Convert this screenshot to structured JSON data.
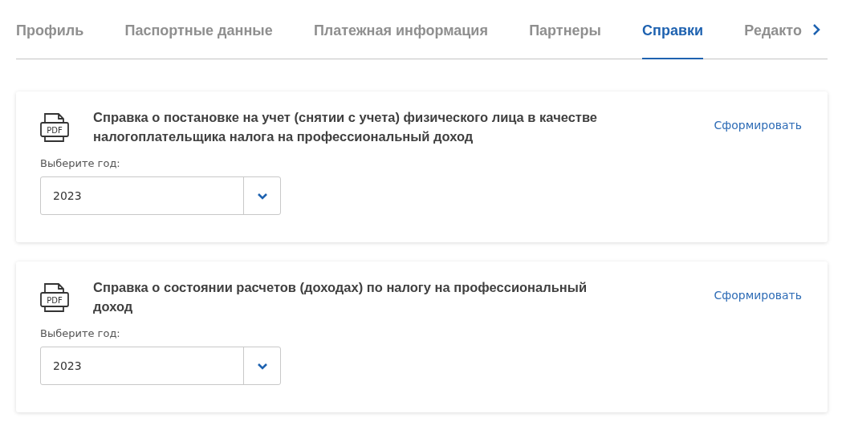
{
  "tabs": [
    {
      "label": "Профиль",
      "selected": false
    },
    {
      "label": "Паспортные данные",
      "selected": false
    },
    {
      "label": "Платежная информация",
      "selected": false
    },
    {
      "label": "Партнеры",
      "selected": false
    },
    {
      "label": "Справки",
      "selected": true
    },
    {
      "label": "Редакто",
      "selected": false
    }
  ],
  "certificates": [
    {
      "title": "Справка о постановке на учет (снятии с учета) физического лица в качестве налогоплательщика налога на профессиональный доход",
      "icon_text": "PDF",
      "action": "Сформировать",
      "year_label": "Выберите год:",
      "year": "2023"
    },
    {
      "title": "Справка о состоянии расчетов (доходах) по налогу на профессиональный доход",
      "icon_text": "PDF",
      "action": "Сформировать",
      "year_label": "Выберите год:",
      "year": "2023"
    }
  ]
}
